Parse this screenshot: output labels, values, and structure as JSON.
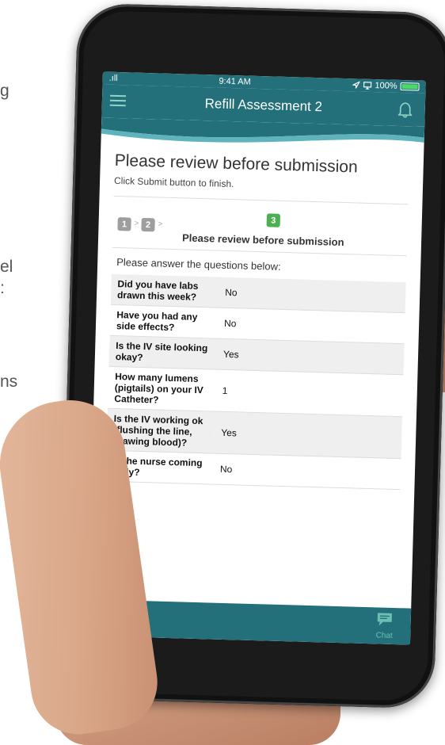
{
  "background_text": {
    "line1": "g",
    "line2": "el",
    "line3": ":",
    "line4": "ns"
  },
  "status_bar": {
    "signal": ".ıll",
    "time": "9:41 AM",
    "battery": "100%"
  },
  "header": {
    "title": "Refill Assessment 2",
    "menu_icon": "hamburger-menu-icon",
    "bell_icon": "bell-icon"
  },
  "page": {
    "title": "Please review before submission",
    "subtitle": "Click Submit button to finish."
  },
  "steps": {
    "items": [
      "1",
      "2",
      "3"
    ],
    "separator": ">",
    "active_title": "Please review before submission",
    "inactive_color": "#9e9e9e",
    "active_color": "#4caf50"
  },
  "questions": {
    "intro": "Please answer the questions below:",
    "rows": [
      {
        "question": "Did you have labs drawn this week?",
        "answer": "No"
      },
      {
        "question": "Have you had any side effects?",
        "answer": "No"
      },
      {
        "question": "Is the IV site looking okay?",
        "answer": "Yes"
      },
      {
        "question": "How many lumens (pigtails) on your IV Catheter?",
        "answer": "1"
      },
      {
        "question": "Is the IV working ok (flushing the line, drawing blood)?",
        "answer": "Yes"
      },
      {
        "question": "Is the nurse coming daily?",
        "answer": "No"
      }
    ]
  },
  "bottom_bar": {
    "back_icon": "arrow-left-icon",
    "chat_icon": "chat-bubble-icon",
    "chat_label": "Chat"
  },
  "colors": {
    "brand_teal": "#23707a",
    "accent_mint": "#8fd3c8"
  }
}
